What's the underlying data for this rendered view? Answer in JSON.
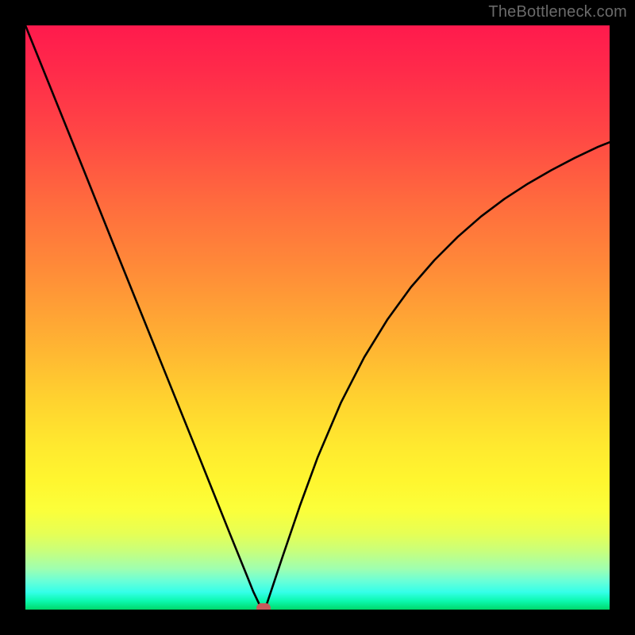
{
  "watermark": {
    "text": "TheBottleneck.com"
  },
  "chart_data": {
    "type": "line",
    "title": "",
    "xlabel": "",
    "ylabel": "",
    "xlim": [
      0,
      1
    ],
    "ylim": [
      0,
      1
    ],
    "grid": false,
    "series": [
      {
        "name": "curve",
        "x": [
          0.0,
          0.05,
          0.1,
          0.15,
          0.2,
          0.25,
          0.3,
          0.35,
          0.38,
          0.39,
          0.4,
          0.406,
          0.412,
          0.42,
          0.44,
          0.47,
          0.5,
          0.54,
          0.58,
          0.62,
          0.66,
          0.7,
          0.74,
          0.78,
          0.82,
          0.86,
          0.9,
          0.94,
          0.98,
          1.0
        ],
        "y": [
          1.0,
          0.876,
          0.752,
          0.627,
          0.503,
          0.379,
          0.255,
          0.13,
          0.056,
          0.031,
          0.01,
          0.002,
          0.006,
          0.03,
          0.09,
          0.178,
          0.26,
          0.354,
          0.432,
          0.497,
          0.552,
          0.598,
          0.638,
          0.673,
          0.703,
          0.729,
          0.752,
          0.773,
          0.792,
          0.8
        ]
      }
    ],
    "marker": {
      "x": 0.408,
      "y": 0.003,
      "color": "#c95a5a"
    },
    "background_gradient_stops": [
      {
        "pos": 0.0,
        "color": "#ff1a4d"
      },
      {
        "pos": 0.5,
        "color": "#ffb133"
      },
      {
        "pos": 0.8,
        "color": "#fff62f"
      },
      {
        "pos": 1.0,
        "color": "#00d86a"
      }
    ]
  }
}
